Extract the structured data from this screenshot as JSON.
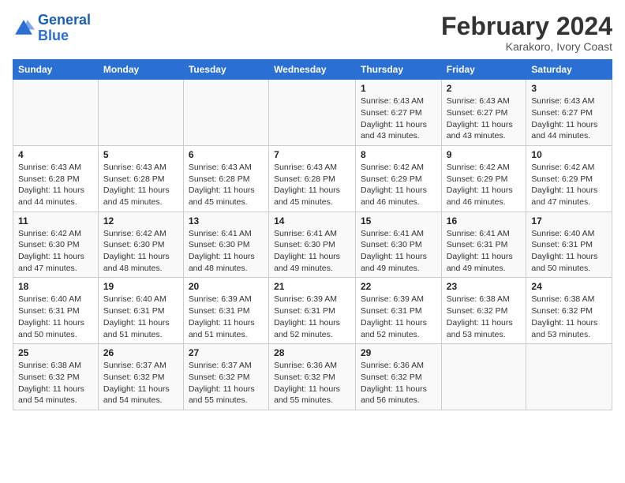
{
  "logo": {
    "text_general": "General",
    "text_blue": "Blue"
  },
  "title": "February 2024",
  "subtitle": "Karakoro, Ivory Coast",
  "days_header": [
    "Sunday",
    "Monday",
    "Tuesday",
    "Wednesday",
    "Thursday",
    "Friday",
    "Saturday"
  ],
  "weeks": [
    [
      {
        "num": "",
        "sunrise": "",
        "sunset": "",
        "daylight": ""
      },
      {
        "num": "",
        "sunrise": "",
        "sunset": "",
        "daylight": ""
      },
      {
        "num": "",
        "sunrise": "",
        "sunset": "",
        "daylight": ""
      },
      {
        "num": "",
        "sunrise": "",
        "sunset": "",
        "daylight": ""
      },
      {
        "num": "1",
        "sunrise": "Sunrise: 6:43 AM",
        "sunset": "Sunset: 6:27 PM",
        "daylight": "Daylight: 11 hours and 43 minutes."
      },
      {
        "num": "2",
        "sunrise": "Sunrise: 6:43 AM",
        "sunset": "Sunset: 6:27 PM",
        "daylight": "Daylight: 11 hours and 43 minutes."
      },
      {
        "num": "3",
        "sunrise": "Sunrise: 6:43 AM",
        "sunset": "Sunset: 6:27 PM",
        "daylight": "Daylight: 11 hours and 44 minutes."
      }
    ],
    [
      {
        "num": "4",
        "sunrise": "Sunrise: 6:43 AM",
        "sunset": "Sunset: 6:28 PM",
        "daylight": "Daylight: 11 hours and 44 minutes."
      },
      {
        "num": "5",
        "sunrise": "Sunrise: 6:43 AM",
        "sunset": "Sunset: 6:28 PM",
        "daylight": "Daylight: 11 hours and 45 minutes."
      },
      {
        "num": "6",
        "sunrise": "Sunrise: 6:43 AM",
        "sunset": "Sunset: 6:28 PM",
        "daylight": "Daylight: 11 hours and 45 minutes."
      },
      {
        "num": "7",
        "sunrise": "Sunrise: 6:43 AM",
        "sunset": "Sunset: 6:28 PM",
        "daylight": "Daylight: 11 hours and 45 minutes."
      },
      {
        "num": "8",
        "sunrise": "Sunrise: 6:42 AM",
        "sunset": "Sunset: 6:29 PM",
        "daylight": "Daylight: 11 hours and 46 minutes."
      },
      {
        "num": "9",
        "sunrise": "Sunrise: 6:42 AM",
        "sunset": "Sunset: 6:29 PM",
        "daylight": "Daylight: 11 hours and 46 minutes."
      },
      {
        "num": "10",
        "sunrise": "Sunrise: 6:42 AM",
        "sunset": "Sunset: 6:29 PM",
        "daylight": "Daylight: 11 hours and 47 minutes."
      }
    ],
    [
      {
        "num": "11",
        "sunrise": "Sunrise: 6:42 AM",
        "sunset": "Sunset: 6:30 PM",
        "daylight": "Daylight: 11 hours and 47 minutes."
      },
      {
        "num": "12",
        "sunrise": "Sunrise: 6:42 AM",
        "sunset": "Sunset: 6:30 PM",
        "daylight": "Daylight: 11 hours and 48 minutes."
      },
      {
        "num": "13",
        "sunrise": "Sunrise: 6:41 AM",
        "sunset": "Sunset: 6:30 PM",
        "daylight": "Daylight: 11 hours and 48 minutes."
      },
      {
        "num": "14",
        "sunrise": "Sunrise: 6:41 AM",
        "sunset": "Sunset: 6:30 PM",
        "daylight": "Daylight: 11 hours and 49 minutes."
      },
      {
        "num": "15",
        "sunrise": "Sunrise: 6:41 AM",
        "sunset": "Sunset: 6:30 PM",
        "daylight": "Daylight: 11 hours and 49 minutes."
      },
      {
        "num": "16",
        "sunrise": "Sunrise: 6:41 AM",
        "sunset": "Sunset: 6:31 PM",
        "daylight": "Daylight: 11 hours and 49 minutes."
      },
      {
        "num": "17",
        "sunrise": "Sunrise: 6:40 AM",
        "sunset": "Sunset: 6:31 PM",
        "daylight": "Daylight: 11 hours and 50 minutes."
      }
    ],
    [
      {
        "num": "18",
        "sunrise": "Sunrise: 6:40 AM",
        "sunset": "Sunset: 6:31 PM",
        "daylight": "Daylight: 11 hours and 50 minutes."
      },
      {
        "num": "19",
        "sunrise": "Sunrise: 6:40 AM",
        "sunset": "Sunset: 6:31 PM",
        "daylight": "Daylight: 11 hours and 51 minutes."
      },
      {
        "num": "20",
        "sunrise": "Sunrise: 6:39 AM",
        "sunset": "Sunset: 6:31 PM",
        "daylight": "Daylight: 11 hours and 51 minutes."
      },
      {
        "num": "21",
        "sunrise": "Sunrise: 6:39 AM",
        "sunset": "Sunset: 6:31 PM",
        "daylight": "Daylight: 11 hours and 52 minutes."
      },
      {
        "num": "22",
        "sunrise": "Sunrise: 6:39 AM",
        "sunset": "Sunset: 6:31 PM",
        "daylight": "Daylight: 11 hours and 52 minutes."
      },
      {
        "num": "23",
        "sunrise": "Sunrise: 6:38 AM",
        "sunset": "Sunset: 6:32 PM",
        "daylight": "Daylight: 11 hours and 53 minutes."
      },
      {
        "num": "24",
        "sunrise": "Sunrise: 6:38 AM",
        "sunset": "Sunset: 6:32 PM",
        "daylight": "Daylight: 11 hours and 53 minutes."
      }
    ],
    [
      {
        "num": "25",
        "sunrise": "Sunrise: 6:38 AM",
        "sunset": "Sunset: 6:32 PM",
        "daylight": "Daylight: 11 hours and 54 minutes."
      },
      {
        "num": "26",
        "sunrise": "Sunrise: 6:37 AM",
        "sunset": "Sunset: 6:32 PM",
        "daylight": "Daylight: 11 hours and 54 minutes."
      },
      {
        "num": "27",
        "sunrise": "Sunrise: 6:37 AM",
        "sunset": "Sunset: 6:32 PM",
        "daylight": "Daylight: 11 hours and 55 minutes."
      },
      {
        "num": "28",
        "sunrise": "Sunrise: 6:36 AM",
        "sunset": "Sunset: 6:32 PM",
        "daylight": "Daylight: 11 hours and 55 minutes."
      },
      {
        "num": "29",
        "sunrise": "Sunrise: 6:36 AM",
        "sunset": "Sunset: 6:32 PM",
        "daylight": "Daylight: 11 hours and 56 minutes."
      },
      {
        "num": "",
        "sunrise": "",
        "sunset": "",
        "daylight": ""
      },
      {
        "num": "",
        "sunrise": "",
        "sunset": "",
        "daylight": ""
      }
    ]
  ]
}
